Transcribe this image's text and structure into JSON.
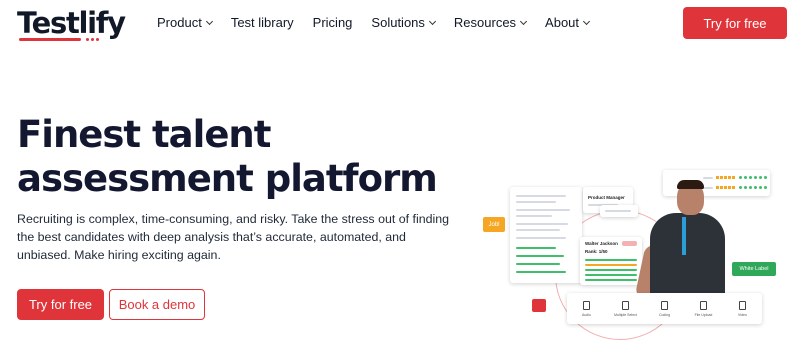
{
  "logo": {
    "text": "Testlify"
  },
  "nav": {
    "items": [
      {
        "label": "Product",
        "has_dropdown": true
      },
      {
        "label": "Test library",
        "has_dropdown": false
      },
      {
        "label": "Pricing",
        "has_dropdown": false
      },
      {
        "label": "Solutions",
        "has_dropdown": true
      },
      {
        "label": "Resources",
        "has_dropdown": true
      },
      {
        "label": "About",
        "has_dropdown": true
      }
    ],
    "cta_label": "Try for free"
  },
  "hero": {
    "title": "Finest talent assessment platform",
    "subtitle": "Recruiting is complex, time-consuming, and risky. Take the stress out of finding the best candidates with deep analysis that’s accurate, automated, and unbiased. Make hiring exciting again.",
    "primary_cta": "Try for free",
    "secondary_cta": "Book a demo"
  },
  "illustration": {
    "yellow_tag": "Jobl",
    "green_tag": "White Label",
    "role_card_title": "Product Manager",
    "candidate_name": "Walter Jackson",
    "candidate_rank": "Rank: 1/50",
    "tools": [
      "Audio",
      "Multiple Select",
      "Coding",
      "File Upload",
      "Video"
    ]
  },
  "colors": {
    "accent": "#e0343b",
    "title": "#131830",
    "green": "#3fbf6b",
    "yellow": "#f5a623"
  }
}
